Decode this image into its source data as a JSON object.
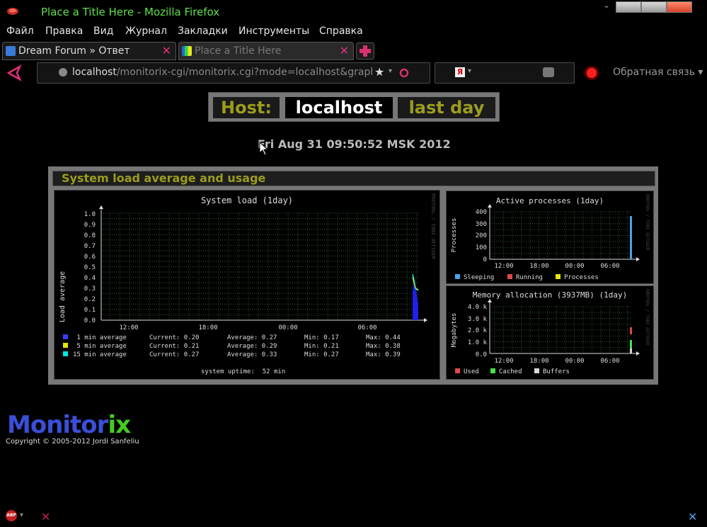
{
  "window": {
    "title": "Place a Title Here - Mozilla Firefox"
  },
  "menu": [
    "Файл",
    "Правка",
    "Вид",
    "Журнал",
    "Закладки",
    "Инструменты",
    "Справка"
  ],
  "tabs": [
    {
      "label": "Dream Forum » Ответ"
    },
    {
      "label": "Place a Title Here"
    }
  ],
  "nav": {
    "url_host": "localhost",
    "url_path": "/monitorix-cgi/monitorix.cgi?mode=localhost&graph=_s",
    "search_icon": "yandex-icon",
    "feedback": "Обратная связь"
  },
  "page": {
    "host_label": "Host:",
    "host_value": "localhost",
    "period": "last day",
    "datetime": "Fri Aug 31 09:50:52 MSK 2012",
    "section_title": "System load average and usage",
    "load_graph": {
      "title": "System load  (1day)",
      "ylabel": "Load average",
      "rrdtool": "RRDTOOL / TOBI OETIKER",
      "yticks": [
        "1.0",
        "0.9",
        "0.8",
        "0.7",
        "0.6",
        "0.5",
        "0.4",
        "0.3",
        "0.2",
        "0.1",
        "0.0"
      ],
      "xticks": [
        "12:00",
        "18:00",
        "00:00",
        "06:00"
      ],
      "legend": [
        {
          "name": " 1 min average",
          "color": "#3c3cff",
          "current": "Current: 0.20",
          "average": "Average: 0.27",
          "min": "Min: 0.17",
          "max": "Max: 0.44"
        },
        {
          "name": " 5 min average",
          "color": "#e8e800",
          "current": "Current: 0.21",
          "average": "Average: 0.29",
          "min": "Min: 0.21",
          "max": "Max: 0.38"
        },
        {
          "name": "15 min average",
          "color": "#00e8e8",
          "current": "Current: 0.27",
          "average": "Average: 0.33",
          "min": "Min: 0.27",
          "max": "Max: 0.39"
        }
      ],
      "uptime": "system uptime:  52 min"
    },
    "proc_graph": {
      "title": "Active processes  (1day)",
      "ylabel": "Processes",
      "rrdtool": "RRDTOOL / TOBI OETIKER",
      "yticks": [
        "400",
        "300",
        "200",
        "100",
        "0"
      ],
      "xticks": [
        "12:00",
        "18:00",
        "00:00",
        "06:00"
      ],
      "legend": [
        {
          "name": "Sleeping",
          "color": "#4aa3e8"
        },
        {
          "name": "Running",
          "color": "#e04848"
        },
        {
          "name": "Processes",
          "color": "#e8e800"
        }
      ]
    },
    "mem_graph": {
      "title": "Memory allocation (3937MB)  (1day)",
      "ylabel": "Megabytes",
      "rrdtool": "RRDTOOL / TOBI OETIKER",
      "yticks": [
        "4.0 k",
        "3.0 k",
        "2.0 k",
        "1.0 k",
        "0.0"
      ],
      "xticks": [
        "12:00",
        "18:00",
        "00:00",
        "06:00"
      ],
      "legend": [
        {
          "name": "Used",
          "color": "#e04848"
        },
        {
          "name": "Cached",
          "color": "#48e048"
        },
        {
          "name": "Buffers",
          "color": "#d8d8d8"
        }
      ]
    },
    "logo_a": "Monitor",
    "logo_b": "ix",
    "copyright": "Copyright © 2005-2012 Jordi Sanfeliu"
  },
  "status": {
    "abp": "ABP"
  },
  "colors": {
    "accent_olive": "#9c9c1e",
    "title_green": "#5fe04a",
    "logo_blue": "#3a4fd8",
    "logo_green": "#44cc22"
  }
}
